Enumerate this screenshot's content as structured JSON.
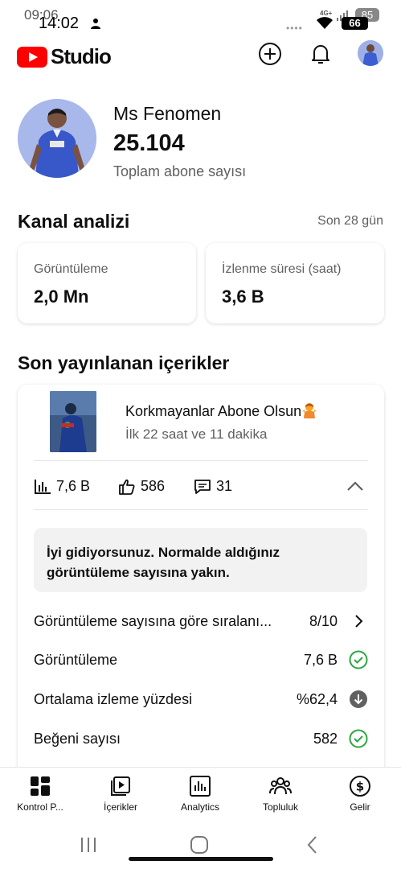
{
  "status_bar": {
    "time_back": "09:06",
    "time": "14:02",
    "network": "4G+",
    "battery_back": "85",
    "battery": "66"
  },
  "header": {
    "app_name": "Studio",
    "brand_color": "#ff0000"
  },
  "channel": {
    "name": "Ms Fenomen",
    "subscribers": "25.104",
    "subscribers_label": "Toplam abone sayısı"
  },
  "analytics": {
    "title": "Kanal analizi",
    "period": "Son 28 gün",
    "metrics": [
      {
        "label": "Görüntüleme",
        "value": "2,0 Mn"
      },
      {
        "label": "İzlenme süresi (saat)",
        "value": "3,6 B"
      }
    ]
  },
  "recent": {
    "title": "Son yayınlanan içerikler",
    "video": {
      "title": "Korkmayanlar Abone Olsun",
      "subtitle": "İlk 22 saat ve 11 dakika"
    },
    "stats": {
      "views": "7,6 B",
      "likes": "586",
      "comments": "31"
    },
    "info": "İyi gidiyorsunuz. Normalde aldığınız görüntüleme sayısına yakın.",
    "rows": [
      {
        "label": "Görüntüleme sayısına göre sıralanı...",
        "value": "8/10",
        "icon": "chevron-right-icon"
      },
      {
        "label": "Görüntüleme",
        "value": "7,6 B",
        "icon": "check-circle-icon"
      },
      {
        "label": "Ortalama izleme yüzdesi",
        "value": "%62,4",
        "icon": "down-arrow-circle-icon"
      },
      {
        "label": "Beğeni sayısı",
        "value": "582",
        "icon": "check-circle-icon"
      }
    ],
    "colors": {
      "positive": "#2ba640",
      "neutral": "#606060"
    }
  },
  "bottom_nav": [
    {
      "label": "Kontrol P...",
      "icon": "dashboard-icon"
    },
    {
      "label": "İçerikler",
      "icon": "content-icon"
    },
    {
      "label": "Analytics",
      "icon": "analytics-icon"
    },
    {
      "label": "Topluluk",
      "icon": "community-icon"
    },
    {
      "label": "Gelir",
      "icon": "earn-icon"
    }
  ]
}
